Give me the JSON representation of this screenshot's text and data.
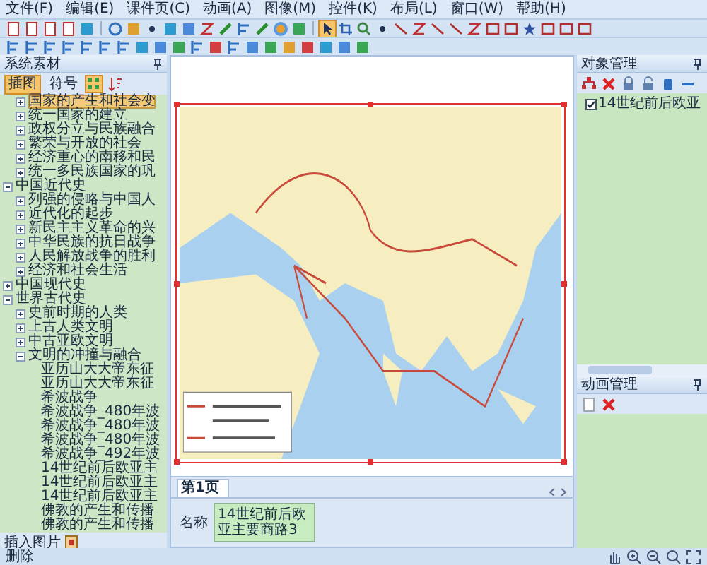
{
  "menu": [
    "文件(F)",
    "编辑(E)",
    "课件页(C)",
    "动画(A)",
    "图像(M)",
    "控件(K)",
    "布局(L)",
    "窗口(W)",
    "帮助(H)"
  ],
  "left_panel": {
    "title": "系统素材",
    "tabs": [
      {
        "label": "插图",
        "selected": true
      },
      {
        "label": "符号",
        "selected": false
      }
    ],
    "tree": {
      "continued_items": [
        {
          "label": "国家的产生和社会变",
          "expanded": false,
          "selected": true
        },
        {
          "label": "统一国家的建立",
          "expanded": false,
          "selected": false
        },
        {
          "label": "政权分立与民族融合",
          "expanded": false,
          "selected": false
        },
        {
          "label": "繁荣与开放的社会",
          "expanded": false,
          "selected": false
        },
        {
          "label": "经济重心的南移和民",
          "expanded": false,
          "selected": false
        },
        {
          "label": "统一多民族国家的巩",
          "expanded": false,
          "selected": false
        }
      ],
      "items": [
        {
          "label": "中国近代史",
          "expanded": true,
          "selected": false,
          "children": [
            {
              "label": "列强的侵略与中国人",
              "expanded": false,
              "selected": false
            },
            {
              "label": "近代化的起步",
              "expanded": false,
              "selected": false
            },
            {
              "label": "新民主主义革命的兴",
              "expanded": false,
              "selected": false
            },
            {
              "label": "中华民族的抗日战争",
              "expanded": false,
              "selected": false
            },
            {
              "label": "人民解放战争的胜利",
              "expanded": false,
              "selected": false
            },
            {
              "label": "经济和社会生活",
              "expanded": false,
              "selected": false
            }
          ]
        },
        {
          "label": "中国现代史",
          "expanded": false,
          "selected": false
        },
        {
          "label": "世界古代史",
          "expanded": true,
          "selected": false,
          "children": [
            {
              "label": "史前时期的人类",
              "expanded": false,
              "selected": false
            },
            {
              "label": "上古人类文明",
              "expanded": false,
              "selected": false
            },
            {
              "label": "中古亚欧文明",
              "expanded": false,
              "selected": false
            },
            {
              "label": "文明的冲撞与融合",
              "expanded": true,
              "selected": false,
              "children": [
                {
                  "label": "亚历山大大帝东征",
                  "selected": false
                },
                {
                  "label": "亚历山大大帝东征",
                  "selected": false
                },
                {
                  "label": "希波战争",
                  "selected": false
                },
                {
                  "label": "希波战争_480年波",
                  "selected": false
                },
                {
                  "label": "希波战争_480年波",
                  "selected": false
                },
                {
                  "label": "希波战争_480年波",
                  "selected": false
                },
                {
                  "label": "希波战争_492年波",
                  "selected": false
                },
                {
                  "label": "14世纪前后欧亚主",
                  "selected": false
                },
                {
                  "label": "14世纪前后欧亚主",
                  "selected": false
                },
                {
                  "label": "14世纪前后欧亚主",
                  "selected": false
                },
                {
                  "label": "佛教的产生和传播",
                  "selected": false
                },
                {
                  "label": "佛教的产生和传播",
                  "selected": false
                }
              ]
            }
          ]
        }
      ]
    },
    "insert_button": "插入图片"
  },
  "page_tabs": [
    {
      "label": "第1页",
      "selected": true
    }
  ],
  "properties": {
    "name_label": "名称",
    "name_value": "14世纪前后欧亚主要商路3"
  },
  "object_panel": {
    "title": "对象管理",
    "objects": [
      {
        "label": "14世纪前后欧亚",
        "checked": true
      }
    ]
  },
  "animation_panel": {
    "title": "动画管理"
  },
  "status_bar": {
    "text": "删除"
  }
}
